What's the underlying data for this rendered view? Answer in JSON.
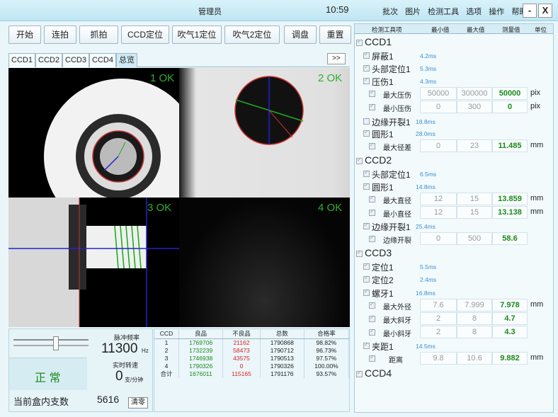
{
  "title": {
    "role": "管理员",
    "clock": "10:59",
    "menu": [
      "批次",
      "图片",
      "检测工具",
      "选项",
      "操作",
      "帮助"
    ],
    "minimize": "-",
    "close": "X"
  },
  "toolbar": [
    "开始",
    "连拍",
    "抓拍",
    "CCD定位",
    "吹气1定位",
    "吹气2定位",
    "调盘",
    "重置"
  ],
  "tabs": [
    "CCD1",
    "CCD2",
    "CCD3",
    "CCD4",
    "总览"
  ],
  "more": ">>",
  "cams": [
    "1 OK",
    "2 OK",
    "3 OK",
    "4 OK"
  ],
  "panel": {
    "pulse_label": "脉冲频率",
    "pulse_value": "11300",
    "pulse_unit": "Hz",
    "speed_label": "实时转速",
    "speed_value": "0",
    "speed_unit": "支/分钟",
    "status": "正 常",
    "slider_level": 0.57,
    "count_label": "当前盒内支数",
    "count_value": "5616",
    "clear": "清零"
  },
  "stats": {
    "headers": [
      "CCD",
      "良品",
      "不良品",
      "总数",
      "合格率"
    ],
    "rows": [
      [
        "1",
        "1769706",
        "21162",
        "1790868",
        "98.82%"
      ],
      [
        "2",
        "1732239",
        "58473",
        "1790712",
        "96.73%"
      ],
      [
        "3",
        "1746938",
        "43575",
        "1790513",
        "97.57%"
      ],
      [
        "4",
        "1790326",
        "0",
        "1790326",
        "100.00%"
      ],
      [
        "合计",
        "1676011",
        "115165",
        "1791176",
        "93.57%"
      ]
    ]
  },
  "tools": {
    "headers": [
      "检测工具项",
      "最小值",
      "最大值",
      "测量值",
      "单位"
    ],
    "ccd1": {
      "name": "CCD1",
      "t1": {
        "name": "屏蔽1",
        "ms": "4.2ms"
      },
      "t2": {
        "name": "头部定位1",
        "ms": "5.3ms"
      },
      "t3": {
        "name": "压伤1",
        "ms": "4.3ms",
        "r1": {
          "name": "最大压伤",
          "min": "50000",
          "max": "300000",
          "val": "50000",
          "unit": "pix"
        },
        "r2": {
          "name": "最小压伤",
          "min": "0",
          "max": "300",
          "val": "0",
          "unit": "pix"
        }
      },
      "t4": {
        "name": "边缘开裂1",
        "ms": "18.8ms"
      },
      "t5": {
        "name": "圆形1",
        "ms": "28.0ms",
        "r1": {
          "name": "最大径差",
          "min": "0",
          "max": "23",
          "val": "11.485",
          "unit": "mm"
        }
      }
    },
    "ccd2": {
      "name": "CCD2",
      "t1": {
        "name": "头部定位1",
        "ms": "6.5ms"
      },
      "t2": {
        "name": "圆形1",
        "ms": "14.8ms",
        "r1": {
          "name": "最大直径",
          "min": "12",
          "max": "15",
          "val": "13.859",
          "unit": "mm"
        },
        "r2": {
          "name": "最小直径",
          "min": "12",
          "max": "15",
          "val": "13.138",
          "unit": "mm"
        }
      },
      "t3": {
        "name": "边缘开裂1",
        "ms": "25.4ms",
        "r1": {
          "name": "边缘开裂",
          "min": "0",
          "max": "500",
          "val": "58.6",
          "unit": ""
        }
      }
    },
    "ccd3": {
      "name": "CCD3",
      "t1": {
        "name": "定位1",
        "ms": "5.5ms"
      },
      "t2": {
        "name": "定位2",
        "ms": "2.4ms"
      },
      "t3": {
        "name": "螺牙1",
        "ms": "16.8ms",
        "r1": {
          "name": "最大外径",
          "min": "7.6",
          "max": "7.999",
          "val": "7.978",
          "unit": "mm"
        },
        "r2": {
          "name": "最大斜牙",
          "min": "2",
          "max": "8",
          "val": "4.7",
          "unit": ""
        },
        "r3": {
          "name": "最小斜牙",
          "min": "2",
          "max": "8",
          "val": "4.3",
          "unit": ""
        }
      },
      "t4": {
        "name": "夹距1",
        "ms": "14.5ms",
        "r1": {
          "name": "距离",
          "min": "9.8",
          "max": "10.6",
          "val": "9.882",
          "unit": "mm"
        }
      }
    },
    "ccd4": {
      "name": "CCD4"
    }
  }
}
